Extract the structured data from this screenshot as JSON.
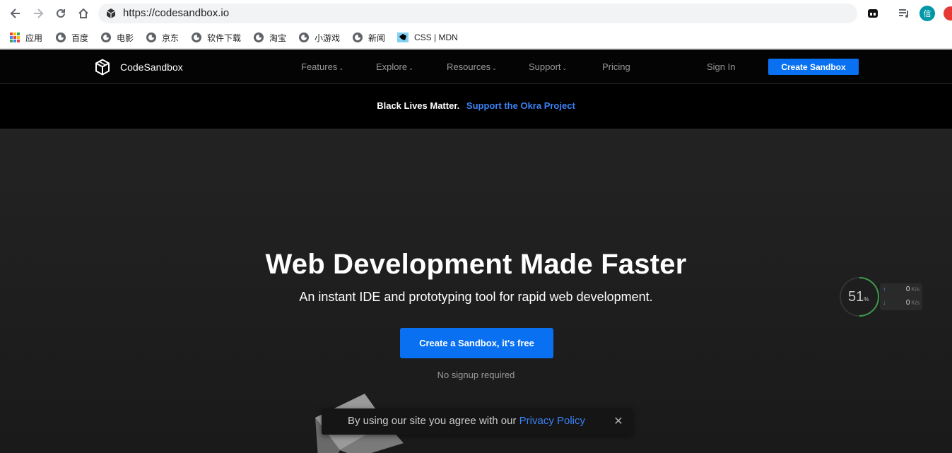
{
  "browser": {
    "url": "https://codesandbox.io",
    "profile_initial": "信",
    "bookmarks": [
      {
        "label": "应用",
        "icon": "apps-icon"
      },
      {
        "label": "百度",
        "icon": "globe-icon"
      },
      {
        "label": "电影",
        "icon": "globe-icon"
      },
      {
        "label": "京东",
        "icon": "globe-icon"
      },
      {
        "label": "软件下载",
        "icon": "globe-icon"
      },
      {
        "label": "淘宝",
        "icon": "globe-icon"
      },
      {
        "label": "小游戏",
        "icon": "globe-icon"
      },
      {
        "label": "新闻",
        "icon": "globe-icon"
      },
      {
        "label": "CSS | MDN",
        "icon": "mdn-icon"
      }
    ]
  },
  "header": {
    "brand": "CodeSandbox",
    "nav": [
      {
        "label": "Features",
        "dropdown": true
      },
      {
        "label": "Explore",
        "dropdown": true
      },
      {
        "label": "Resources",
        "dropdown": true
      },
      {
        "label": "Support",
        "dropdown": true
      },
      {
        "label": "Pricing",
        "dropdown": false
      }
    ],
    "sign_in": "Sign In",
    "create_button": "Create Sandbox"
  },
  "banner": {
    "text": "Black Lives Matter.",
    "link": "Support the Okra Project"
  },
  "hero": {
    "title": "Web Development Made Faster",
    "subtitle": "An instant IDE and prototyping tool for rapid web development.",
    "cta": "Create a Sandbox, it's free",
    "note": "No signup required"
  },
  "network_widget": {
    "percent": "51",
    "percent_unit": "%",
    "upload": "0",
    "download": "0",
    "unit": "K/s"
  },
  "cookie_notice": {
    "text": "By using our site you agree with our ",
    "link": "Privacy Policy",
    "close": "✕"
  },
  "colors": {
    "accent": "#0971f1",
    "link": "#3b82f6",
    "header_bg": "#040404"
  }
}
